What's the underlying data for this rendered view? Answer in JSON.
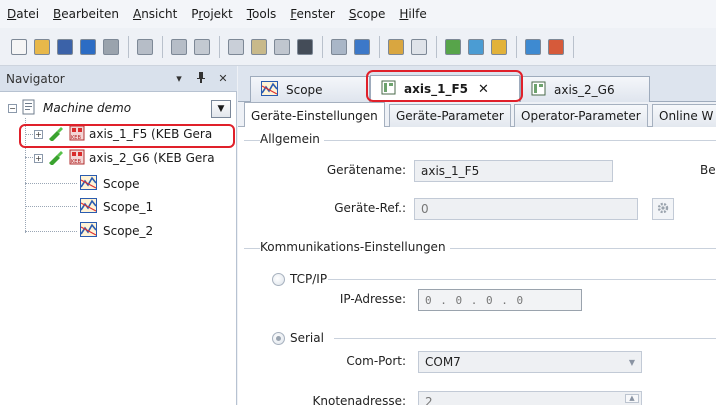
{
  "menu": [
    {
      "pre": "",
      "u": "D",
      "post": "atei"
    },
    {
      "pre": "",
      "u": "B",
      "post": "earbeiten"
    },
    {
      "pre": "",
      "u": "A",
      "post": "nsicht"
    },
    {
      "pre": "P",
      "u": "r",
      "post": "ojekt"
    },
    {
      "pre": "",
      "u": "T",
      "post": "ools"
    },
    {
      "pre": "",
      "u": "F",
      "post": "enster"
    },
    {
      "pre": "",
      "u": "S",
      "post": "cope"
    },
    {
      "pre": "",
      "u": "H",
      "post": "ilfe"
    }
  ],
  "toolbar_icons": [
    "new-file-icon",
    "open-folder-icon",
    "save-icon",
    "import-icon",
    "print-icon",
    "undo-icon",
    "redo-icon",
    "cut-icon",
    "copy-icon",
    "paste-icon",
    "delete-icon",
    "find-icon",
    "replace-icon",
    "network-icon",
    "device-add-icon",
    "device-config-icon",
    "connect-icon",
    "device-scan-icon",
    "key-icon",
    "download-icon",
    "scope-icon"
  ],
  "navigator": {
    "title": "Navigator",
    "pin_label": "▾",
    "dock_label": "ᵽ",
    "close_label": "✕",
    "root": "Machine demo",
    "items": [
      {
        "label": "axis_1_F5 (KEB Gera",
        "type": "device"
      },
      {
        "label": "axis_2_G6 (KEB Gera",
        "type": "device"
      },
      {
        "label": "Scope",
        "type": "scope"
      },
      {
        "label": "Scope_1",
        "type": "scope"
      },
      {
        "label": "Scope_2",
        "type": "scope"
      }
    ]
  },
  "doc_tabs": [
    {
      "label": "Scope"
    },
    {
      "label": "axis_1_F5",
      "close": "✕"
    },
    {
      "label": "axis_2_G6"
    }
  ],
  "sub_tabs": [
    "Geräte-Einstellungen",
    "Geräte-Parameter",
    "Operator-Parameter",
    "Online W"
  ],
  "form": {
    "group_general": "Allgemein",
    "device_name_label": "Gerätename:",
    "device_name_value": "axis_1_F5",
    "be_label": "Be",
    "device_ref_label": "Geräte-Ref.:",
    "device_ref_value": "0",
    "group_comm": "Kommunikations-Einstellungen",
    "tcpip_label": "TCP/IP",
    "ip_label": "IP-Adresse:",
    "ip_value": "0  .  0  .  0  .  0",
    "serial_label": "Serial",
    "comport_label": "Com-Port:",
    "comport_value": "COM7",
    "node_label": "Knotenadresse:",
    "node_value": "2"
  },
  "colors": {
    "highlight": "#e0202a",
    "keb_green": "#3aa32f",
    "keb_red": "#d92b2b"
  }
}
